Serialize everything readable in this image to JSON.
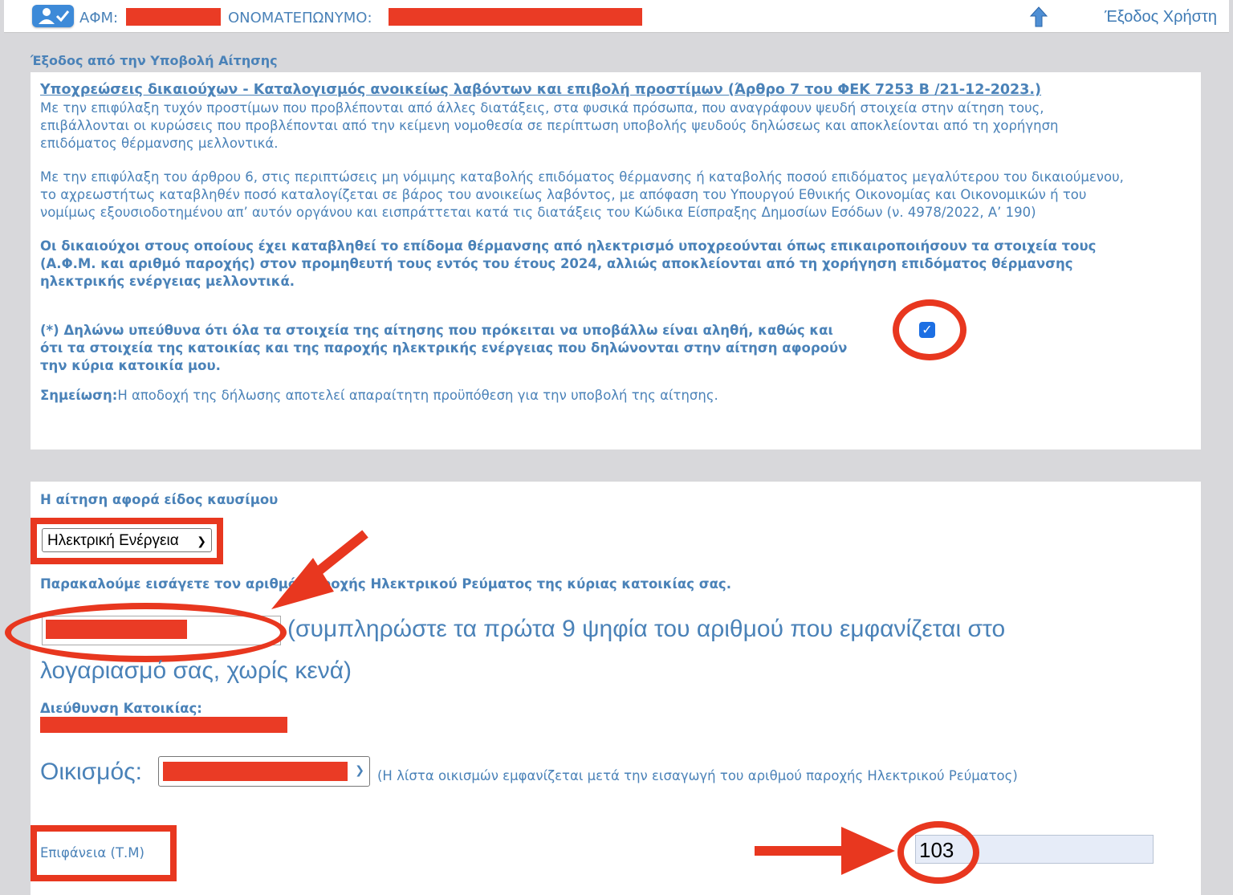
{
  "header": {
    "afm_label": "ΑΦΜ:",
    "name_label": "ΟΝΟΜΑΤΕΠΩΝΥΜΟ:",
    "exit_label": "Έξοδος Χρήστη"
  },
  "section_title": "Έξοδος από την Υποβολή Αίτησης",
  "obligations": {
    "heading": "Υποχρεώσεις δικαιούχων - Καταλογισμός ανοικείως λαβόντων και επιβολή προστίμων (Άρθρο 7 του ΦΕΚ 7253 Β /21-12-2023.)",
    "para1_lines": [
      "Με την επιφύλαξη τυχόν προστίμων που προβλέπονται από άλλες διατάξεις, στα φυσικά πρόσωπα, που αναγράφουν ψευδή στοιχεία στην αίτηση τους,",
      "επιβάλλονται οι κυρώσεις που προβλέπονται από την κείμενη νομοθεσία σε περίπτωση υποβολής ψευδούς δηλώσεως και αποκλείονται από τη χορήγηση",
      "επιδόματος θέρμανσης μελλοντικά."
    ],
    "para2_lines": [
      "Με την επιφύλαξη του άρθρου 6, στις περιπτώσεις μη νόμιμης καταβολής επιδόματος θέρμανσης ή καταβολής ποσού επιδόματος μεγαλύτερου του δικαιούμενου,",
      "το αχρεωστήτως καταβληθέν ποσό καταλογίζεται σε βάρος του ανοικείως λαβόντος, με απόφαση του Υπουργού Εθνικής Οικονομίας και Οικονομικών ή του",
      "νομίμως εξουσιοδοτημένου απ’ αυτόν οργάνου και εισπράττεται κατά τις διατάξεις του Κώδικα Είσπραξης Δημοσίων Εσόδων (ν. 4978/2022, Α’ 190)"
    ],
    "para3_lines": [
      "Οι δικαιούχοι στους οποίους έχει καταβληθεί το επίδομα θέρμανσης από ηλεκτρισμό υποχρεούνται όπως επικαιροποιήσουν τα στοιχεία τους",
      "(Α.Φ.Μ. και αριθμό παροχής) στον προμηθευτή τους εντός του έτους 2024, αλλιώς αποκλείονται από τη χορήγηση επιδόματος θέρμανσης",
      "ηλεκτρικής ενέργειας μελλοντικά."
    ],
    "declaration_lines": [
      "(*) Δηλώνω υπεύθυνα ότι όλα τα στοιχεία της αίτησης που πρόκειται να υποβάλλω είναι αληθή, καθώς και",
      "ότι τα στοιχεία της κατοικίας και της παροχής ηλεκτρικής ενέργειας που δηλώνονται στην αίτηση αφορούν",
      "την κύρια κατοικία μου."
    ],
    "declaration_checked": true,
    "note_label": "Σημείωση:",
    "note_text": "Η αποδοχή της δήλωσης αποτελεί απαραίτητη προϋπόθεση για την υποβολή της αίτησης."
  },
  "fuel": {
    "label": "Η αίτηση αφορά είδος καυσίμου",
    "selected": "Ηλεκτρική Ενέργεια",
    "supply_prompt": "Παρακαλούμε εισάγετε τον αριθμό παροχής Ηλεκτρικού Ρεύματος της κύριας κατοικίας σας.",
    "supply_hint_line1": "(συμπληρώστε τα πρώτα 9 ψηφία του αριθμού που εμφανίζεται στο",
    "supply_hint_line2": "λογαριασμό σας, χωρίς κενά)",
    "address_label": "Διεύθυνση Κατοικίας:",
    "settlement_label": "Οικισμός:",
    "settlement_hint": "(Η λίστα οικισμών εμφανίζεται μετά την εισαγωγή του αριθμού παροχής Ηλεκτρικού Ρεύματος)",
    "area_label": "Επιφάνεια (Τ.Μ)",
    "area_value": "103"
  },
  "colors": {
    "text": "#4a82b8",
    "annotation": "#e8371f",
    "redaction": "#ea3b25"
  }
}
